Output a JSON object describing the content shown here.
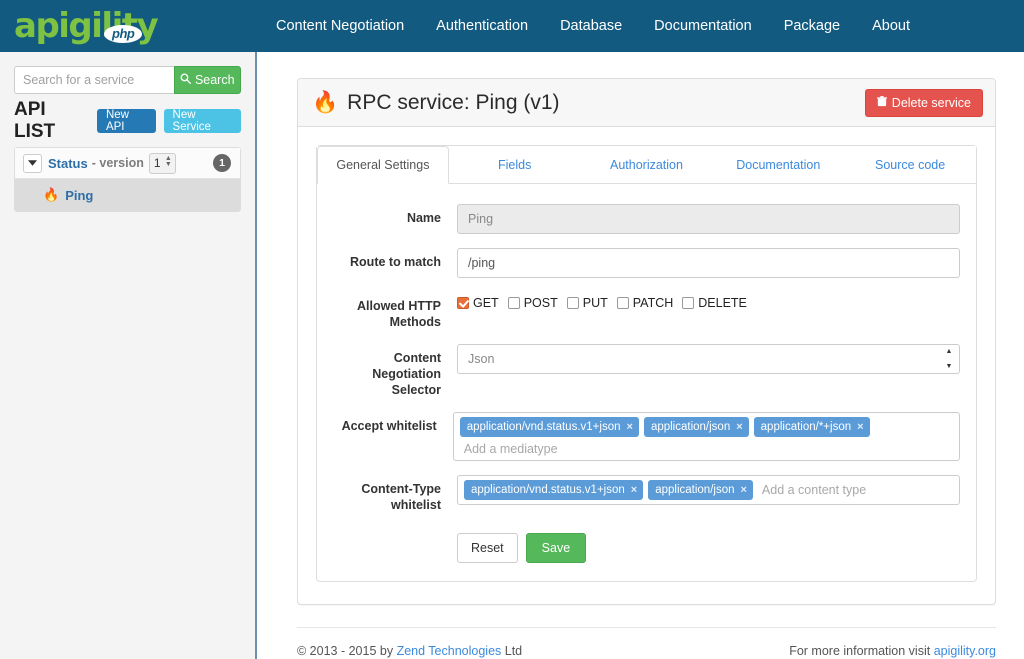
{
  "brand": {
    "name": "apigility",
    "badge": "php"
  },
  "nav": {
    "items": [
      {
        "label": "Content Negotiation",
        "name": "nav-content-negotiation"
      },
      {
        "label": "Authentication",
        "name": "nav-authentication"
      },
      {
        "label": "Database",
        "name": "nav-database"
      },
      {
        "label": "Documentation",
        "name": "nav-documentation"
      },
      {
        "label": "Package",
        "name": "nav-package"
      },
      {
        "label": "About",
        "name": "nav-about"
      }
    ]
  },
  "sidebar": {
    "search": {
      "placeholder": "Search for a service",
      "value": "",
      "button_label": "Search",
      "icon": "search-icon"
    },
    "api_list_title": "API LIST",
    "new_api_label": "New API",
    "new_service_label": "New Service",
    "api": {
      "caret": "▾",
      "name": "Status",
      "version_label": "- version",
      "version_value": "1",
      "count_badge": "1",
      "services": [
        {
          "label": "Ping",
          "icon": "flame-icon"
        }
      ]
    }
  },
  "main": {
    "panel_title": "RPC service: Ping (v1)",
    "panel_title_icon": "flame-icon",
    "delete_button_label": "Delete service",
    "delete_button_icon": "trash-icon",
    "tabs": [
      {
        "label": "General Settings",
        "active": true
      },
      {
        "label": "Fields",
        "active": false
      },
      {
        "label": "Authorization",
        "active": false
      },
      {
        "label": "Documentation",
        "active": false
      },
      {
        "label": "Source code",
        "active": false
      }
    ],
    "form": {
      "name": {
        "label": "Name",
        "value": "Ping",
        "readonly": true
      },
      "route": {
        "label": "Route to match",
        "value": "/ping"
      },
      "http_methods": {
        "label": "Allowed HTTP Methods",
        "options": [
          {
            "label": "GET",
            "checked": true
          },
          {
            "label": "POST",
            "checked": false
          },
          {
            "label": "PUT",
            "checked": false
          },
          {
            "label": "PATCH",
            "checked": false
          },
          {
            "label": "DELETE",
            "checked": false
          }
        ]
      },
      "selector": {
        "label": "Content Negotiation Selector",
        "value": "Json"
      },
      "accept_whitelist": {
        "label": "Accept whitelist",
        "placeholder": "Add a mediatype",
        "tags": [
          "application/vnd.status.v1+json",
          "application/json",
          "application/*+json"
        ]
      },
      "content_type_whitelist": {
        "label": "Content-Type whitelist",
        "placeholder": "Add a content type",
        "tags": [
          "application/vnd.status.v1+json",
          "application/json"
        ]
      },
      "reset_label": "Reset",
      "save_label": "Save"
    }
  },
  "footer": {
    "copyright_prefix": "© 2013 - 2015 by ",
    "copyright_link": "Zend Technologies",
    "copyright_suffix": " Ltd",
    "right_prefix": "For more information visit ",
    "right_link": "apigility.org"
  },
  "colors": {
    "navbar": "#125a80",
    "brand_green": "#7dc243",
    "accent_blue": "#3b8ade",
    "tag_blue": "#5a9bd8",
    "danger_red": "#e4534d",
    "success_green": "#55b85a",
    "checkbox_orange": "#e8703a"
  }
}
